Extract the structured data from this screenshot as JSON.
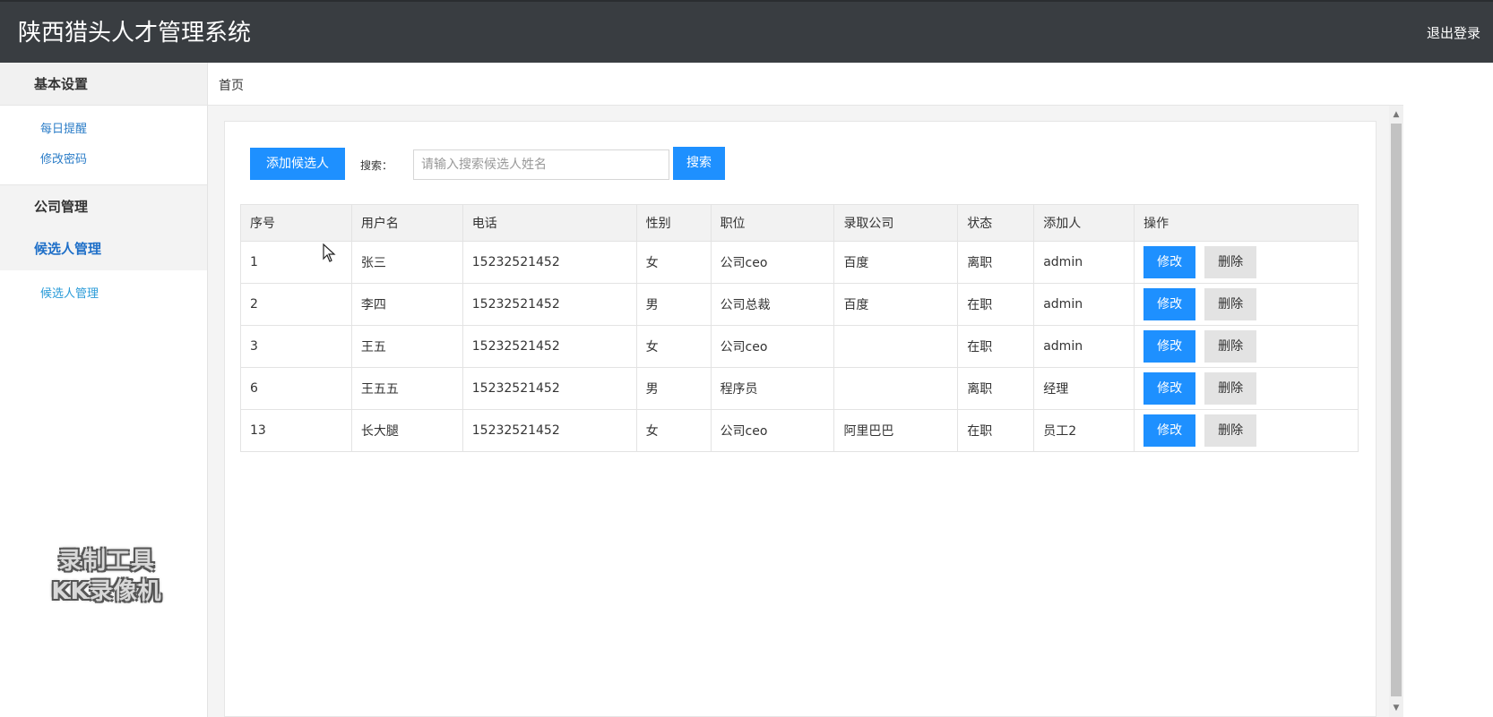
{
  "header": {
    "title": "陕西猎头人才管理系统",
    "logout_label": "退出登录"
  },
  "sidebar": {
    "group_basic": "基本设置",
    "basic_items": [
      "每日提醒",
      "修改密码"
    ],
    "group_company": "公司管理",
    "group_candidate": "候选人管理",
    "candidate_items": [
      "候选人管理"
    ]
  },
  "watermark": {
    "line1": "录制工具",
    "line2": "KK录像机"
  },
  "breadcrumb": "首页",
  "toolbar": {
    "add_label": "添加候选人",
    "search_label": "搜索：",
    "search_placeholder": "请输入搜索候选人姓名",
    "search_button": "搜索"
  },
  "table": {
    "columns": [
      "序号",
      "用户名",
      "电话",
      "性别",
      "职位",
      "录取公司",
      "状态",
      "添加人",
      "操作"
    ],
    "edit_label": "修改",
    "delete_label": "删除",
    "rows": [
      {
        "id": "1",
        "name": "张三",
        "phone": "15232521452",
        "gender": "女",
        "position": "公司ceo",
        "company": "百度",
        "status": "离职",
        "creator": "admin"
      },
      {
        "id": "2",
        "name": "李四",
        "phone": "15232521452",
        "gender": "男",
        "position": "公司总裁",
        "company": "百度",
        "status": "在职",
        "creator": "admin"
      },
      {
        "id": "3",
        "name": "王五",
        "phone": "15232521452",
        "gender": "女",
        "position": "公司ceo",
        "company": "",
        "status": "在职",
        "creator": "admin"
      },
      {
        "id": "6",
        "name": "王五五",
        "phone": "15232521452",
        "gender": "男",
        "position": "程序员",
        "company": "",
        "status": "离职",
        "creator": "经理"
      },
      {
        "id": "13",
        "name": "长大腿",
        "phone": "15232521452",
        "gender": "女",
        "position": "公司ceo",
        "company": "阿里巴巴",
        "status": "在职",
        "creator": "员工2"
      }
    ]
  },
  "colors": {
    "header_bg": "#393d41",
    "primary": "#1e90ff",
    "link": "#2a7cc7"
  }
}
